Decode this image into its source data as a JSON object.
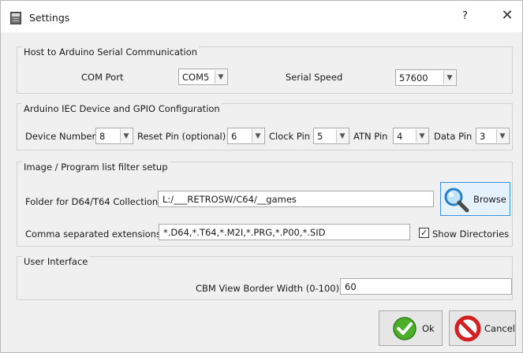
{
  "window": {
    "title": "Settings",
    "help_label": "?",
    "close_label": "✕"
  },
  "serial": {
    "group_title": "Host to Arduino Serial Communication",
    "com_port_label": "COM Port",
    "com_port_value": "COM5",
    "serial_speed_label": "Serial Speed",
    "serial_speed_value": "57600"
  },
  "iec": {
    "group_title": "Arduino IEC Device and GPIO Configuration",
    "device_number_label": "Device Number",
    "device_number_value": "8",
    "reset_pin_label": "Reset Pin (optional)",
    "reset_pin_value": "6",
    "clock_pin_label": "Clock Pin",
    "clock_pin_value": "5",
    "atn_pin_label": "ATN Pin",
    "atn_pin_value": "4",
    "data_pin_label": "Data Pin",
    "data_pin_value": "3"
  },
  "filter": {
    "group_title": "Image / Program list filter setup",
    "folder_label": "Folder for D64/T64 Collection",
    "folder_value": "L:/___RETROSW/C64/__games",
    "browse_label": "Browse",
    "extensions_label": "Comma separated extensions",
    "extensions_value": "*.D64,*.T64,*.M2I,*.PRG,*.P00,*.SID",
    "show_dirs_label": "Show Directories",
    "show_dirs_checked": "✓"
  },
  "ui": {
    "group_title": "User Interface",
    "border_width_label": "CBM View Border Width (0-100)",
    "border_width_value": "60"
  },
  "buttons": {
    "ok_label": "Ok",
    "cancel_label": "Cancel"
  },
  "colors": {
    "ok_icon": "#4caf2a",
    "cancel_icon": "#d32020",
    "browse_border": "#3c8ede"
  }
}
